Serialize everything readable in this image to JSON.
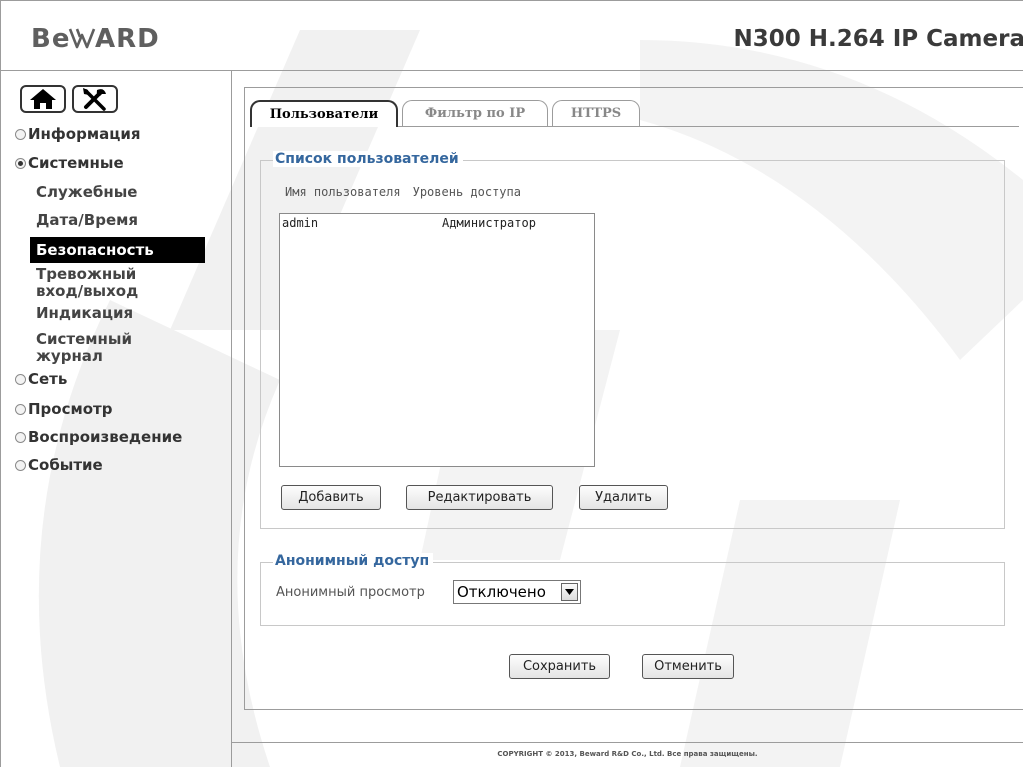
{
  "header": {
    "logo": "BeWARD",
    "camera_title": "N300 H.264 IP Camera"
  },
  "sidebar": {
    "home_icon": "home-icon",
    "tools_icon": "tools-icon",
    "menu": {
      "info": "Информация",
      "system": "Системные",
      "network": "Сеть",
      "view": "Просмотр",
      "playback": "Воспроизведение",
      "event": "Событие"
    },
    "system_subitems": {
      "service": "Служебные",
      "datetime": "Дата/Время",
      "security": "Безопасность",
      "alarm_line1": "Тревожный",
      "alarm_line2": "вход/выход",
      "indication": "Индикация",
      "syslog_line1": "Системный",
      "syslog_line2": "журнал"
    }
  },
  "tabs": [
    "Пользователи",
    "Фильтр по IP",
    "HTTPS"
  ],
  "users_section": {
    "title": "Список пользователей",
    "columns": [
      "Имя пользователя",
      "Уровень доступа"
    ],
    "rows": [
      {
        "name": "admin",
        "level": "Администратор"
      }
    ],
    "add_button": "Добавить",
    "edit_button": "Редактировать",
    "delete_button": "Удалить"
  },
  "anonymous_section": {
    "title": "Анонимный доступ",
    "label": "Анонимный просмотр",
    "selected": "Отключено"
  },
  "actions": {
    "save": "Сохранить",
    "cancel": "Отменить"
  },
  "footer": {
    "copyright": "COPYRIGHT © 2013, Beward R&D Co., Ltd. Все права защищены."
  },
  "colors": {
    "section_title": "#35679e",
    "active_menu_bg": "#000000",
    "watermark": "#f0f0f0"
  }
}
